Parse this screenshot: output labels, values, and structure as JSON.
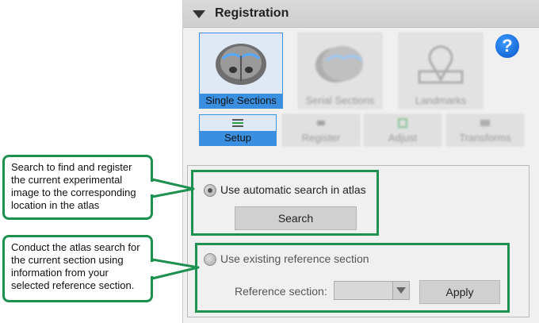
{
  "panel": {
    "title": "Registration",
    "help_label": "?"
  },
  "modes": [
    {
      "label": "Single Sections",
      "selected": true
    },
    {
      "label": "Serial Sections",
      "selected": false
    },
    {
      "label": "Landmarks",
      "selected": false
    }
  ],
  "steps": [
    {
      "label": "Setup",
      "selected": true
    },
    {
      "label": "Register",
      "selected": false
    },
    {
      "label": "Adjust",
      "selected": false
    },
    {
      "label": "Transforms",
      "selected": false
    }
  ],
  "search_option": {
    "label": "Use automatic search in atlas",
    "checked": true,
    "button_label": "Search"
  },
  "reference_option": {
    "label": "Use existing reference section",
    "checked": false,
    "field_label": "Reference section:",
    "select_value": "",
    "button_label": "Apply"
  },
  "callouts": {
    "search": "Search to find and register the current experimental image to the corresponding location in the atlas",
    "reference": "Conduct the atlas search for the current section using information from your selected reference section."
  },
  "colors": {
    "accent": "#3b8fe0",
    "callout_border": "#1e9150",
    "help_icon": "#0a56c8"
  }
}
